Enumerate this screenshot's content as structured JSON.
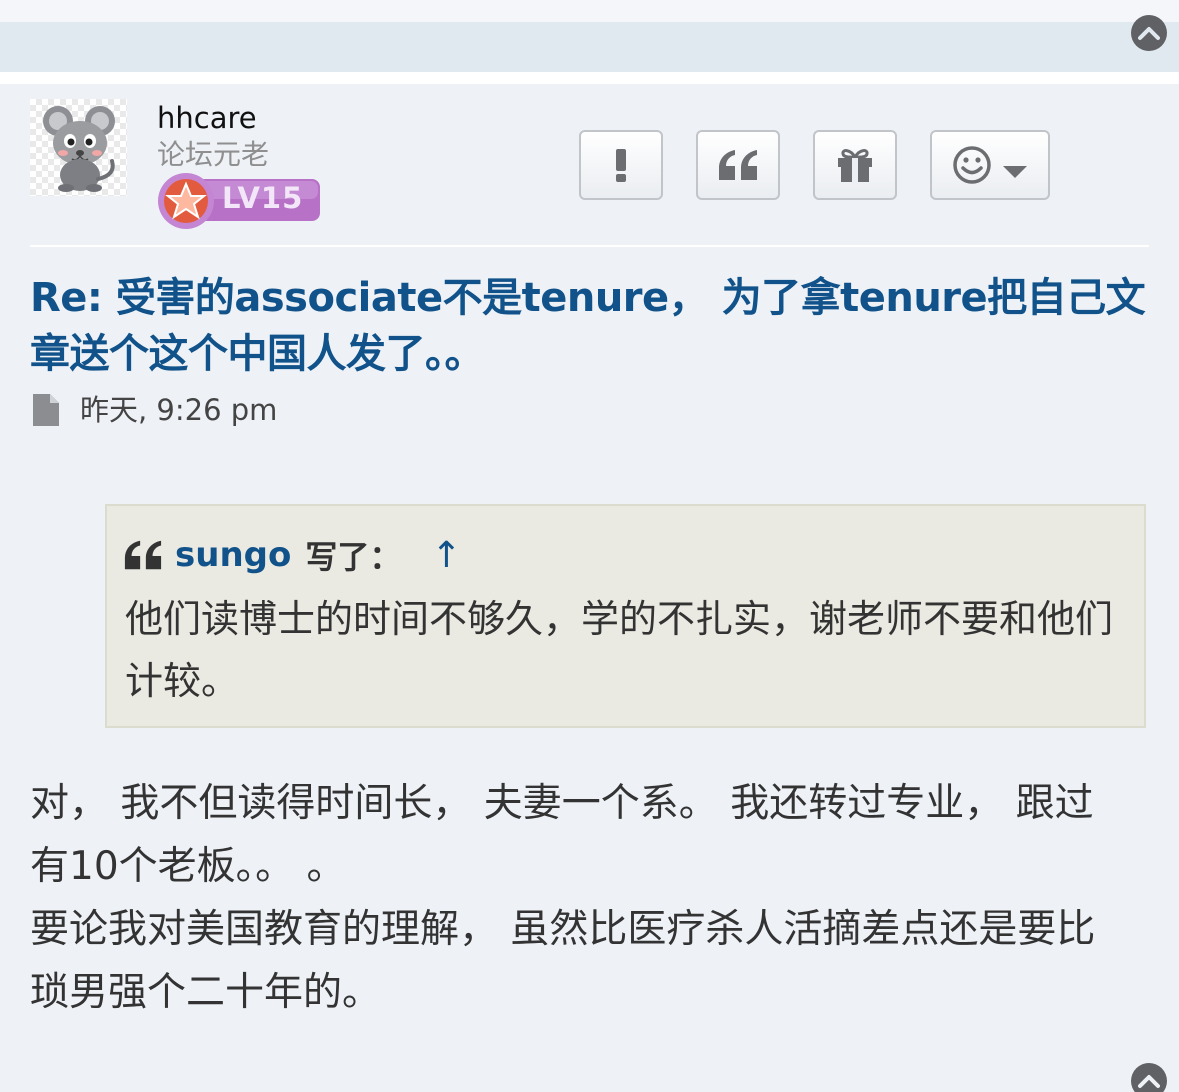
{
  "post": {
    "author": {
      "username": "hhcare",
      "rank": "论坛元老",
      "level": "LV15"
    },
    "actions": [
      {
        "name": "report-button",
        "icon": "exclamation-icon"
      },
      {
        "name": "quote-button",
        "icon": "quote-icon"
      },
      {
        "name": "gift-button",
        "icon": "gift-icon"
      },
      {
        "name": "reaction-button",
        "icon": "smiley-icon"
      }
    ],
    "title": "Re: 受害的associate不是tenure， 为了拿tenure把自己文章送个这个中国人发了。。",
    "timestamp": "昨天, 9:26 pm",
    "quote": {
      "author": "sungo",
      "wrote_label": "写了：",
      "up_arrow": "↑",
      "text": "他们读博士的时间不够久，学的不扎实，谢老师不要和他们计较。"
    },
    "body": [
      "对， 我不但读得时间长， 夫妻一个系。 我还转过专业， 跟过有10个老板。。 。",
      "要论我对美国教育的理解， 虽然比医疗杀人活摘差点还是要比琐男强个二十年的。"
    ]
  },
  "colors": {
    "link_blue": "#105289",
    "page_bg": "#eef2f7",
    "quote_bg": "#ebeae2",
    "level_badge": "#b772c8"
  }
}
